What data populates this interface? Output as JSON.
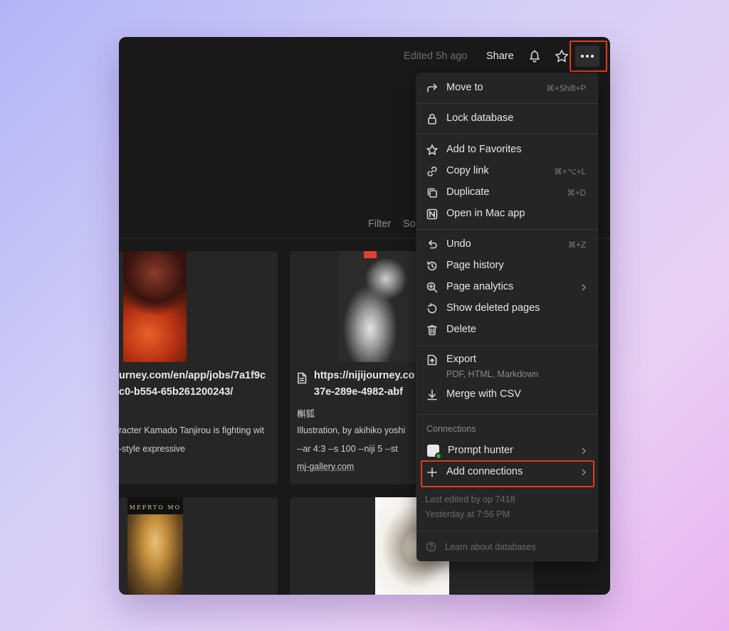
{
  "topbar": {
    "edited": "Edited 5h ago",
    "share": "Share"
  },
  "toolbar": {
    "filter": "Filter",
    "sort": "So"
  },
  "cards": {
    "card1": {
      "title_line1": "urney.com/en/app/jobs/7a1f9c",
      "title_line2": "c0-b554-65b261200243/",
      "desc": "racter Kamado Tanjirou is fighting wit",
      "tags": "-style expressive"
    },
    "card2": {
      "title_line1": "https://nijijourney.co",
      "title_line2": "37e-289e-4982-abf",
      "name": "槲狐",
      "desc": "Illustration, by akihiko yoshi",
      "params": "--ar 4:3 --s 100 --niji 5 --st",
      "link": "mj-gallery.com"
    },
    "card3": {
      "poster_text": "MEPRTO MO"
    }
  },
  "menu": {
    "items": [
      {
        "label": "Move to",
        "shortcut": "⌘+Shift+P",
        "icon": "arrow-right-icon"
      },
      {
        "label": "Lock database",
        "icon": "lock-icon"
      },
      {
        "label": "Add to Favorites",
        "icon": "star-icon"
      },
      {
        "label": "Copy link",
        "shortcut": "⌘+⌥+L",
        "icon": "link-icon"
      },
      {
        "label": "Duplicate",
        "shortcut": "⌘+D",
        "icon": "duplicate-icon"
      },
      {
        "label": "Open in Mac app",
        "icon": "notion-icon"
      },
      {
        "label": "Undo",
        "shortcut": "⌘+Z",
        "icon": "undo-icon"
      },
      {
        "label": "Page history",
        "icon": "history-icon"
      },
      {
        "label": "Page analytics",
        "icon": "analytics-icon"
      },
      {
        "label": "Show deleted pages",
        "icon": "restore-icon"
      },
      {
        "label": "Delete",
        "icon": "trash-icon"
      },
      {
        "label": "Export",
        "sub": "PDF, HTML, Markdown",
        "icon": "export-icon"
      },
      {
        "label": "Merge with CSV",
        "icon": "download-icon"
      }
    ],
    "connections_header": "Connections",
    "prompt_hunter": "Prompt hunter",
    "add_connections": "Add connections",
    "last_edited": "Last edited by op 7418",
    "last_edited_time": "Yesterday at 7:56 PM",
    "learn": "Learn about databases"
  },
  "colors": {
    "highlight": "#e23a1e",
    "window_bg": "#191919",
    "menu_bg": "#252525"
  }
}
